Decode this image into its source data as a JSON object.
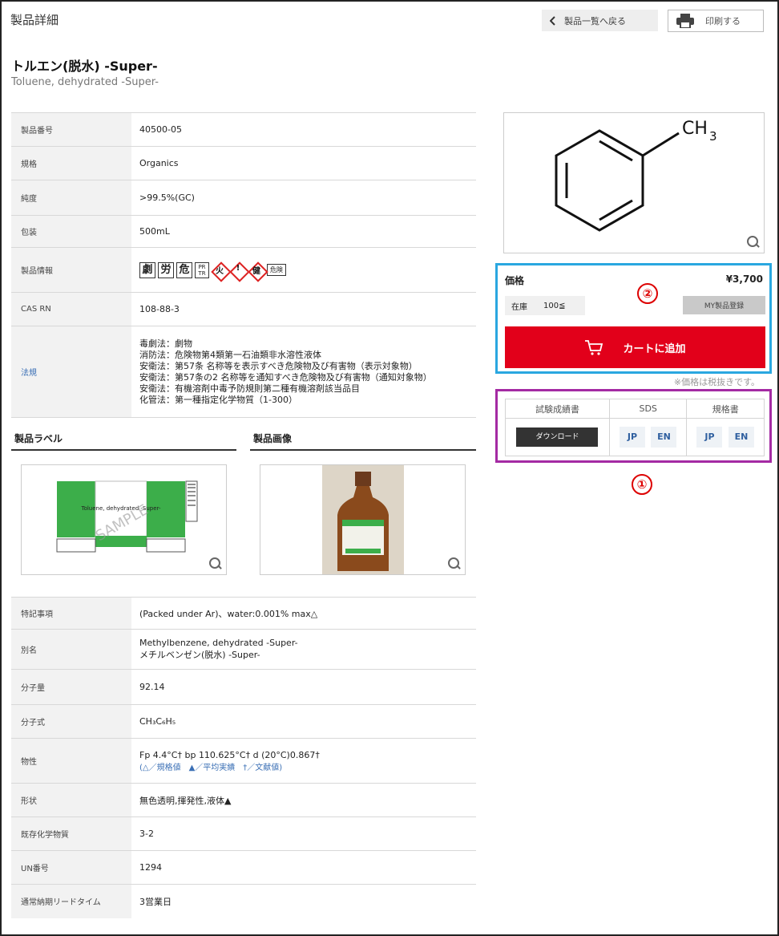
{
  "header": {
    "page_title": "製品詳細",
    "back_label": "製品一覧へ戻る",
    "print_label": "印刷する"
  },
  "product": {
    "name_jp": "トルエン(脱水) -Super-",
    "name_en": "Toluene, dehydrated -Super-"
  },
  "spec_rows": [
    {
      "key": "製品番号",
      "value": "40500-05"
    },
    {
      "key": "規格",
      "value": "Organics"
    },
    {
      "key": "純度",
      "value": ">99.5%(GC)"
    },
    {
      "key": "包装",
      "value": "500mL"
    },
    {
      "key": "製品情報",
      "value": ""
    },
    {
      "key": "CAS RN",
      "value": "108-88-3"
    },
    {
      "key": "法規",
      "value": ""
    }
  ],
  "hazard": {
    "k1": "劇",
    "k2": "労",
    "k3": "危",
    "prtr": "PR TR",
    "d1": "火",
    "d2": "!",
    "d3": "健",
    "kiken": "危険"
  },
  "law_lines": [
    "毒劇法：劇物",
    "消防法：危険物第4類第一石油類非水溶性液体",
    "安衛法：第57条 名称等を表示すべき危険物及び有害物（表示対象物）",
    "安衛法：第57条の2 名称等を通知すべき危険物及び有害物（通知対象物）",
    "安衛法：有機溶剤中毒予防規則第二種有機溶剤該当品目",
    "化管法：第一種指定化学物質（1-300）"
  ],
  "sections": {
    "label_heading": "製品ラベル",
    "image_heading": "製品画像",
    "label_sample_text": "SAMPLE",
    "label_product_text": "Toluene, dehydrated -Super-"
  },
  "structure": {
    "ch3": "CH",
    "ch3_sub": "3"
  },
  "price": {
    "label": "価格",
    "value": "¥3,700",
    "stock_label": "在庫",
    "stock_value": "100≦",
    "my_button": "MY製品登録",
    "cart_button": "カートに追加",
    "badge": "②",
    "tax_note": "※価格は税抜きです。"
  },
  "docs": {
    "col1": "試験成績書",
    "col2": "SDS",
    "col3": "規格書",
    "download": "ダウンロード",
    "jp": "JP",
    "en": "EN",
    "badge": "①"
  },
  "property_rows": [
    {
      "key": "特記事項",
      "value": "(Packed under Ar)、water:0.001% max△"
    },
    {
      "key": "別名",
      "value": "Methylbenzene, dehydrated -Super-",
      "value2": "メチルベンゼン(脱水) -Super-"
    },
    {
      "key": "分子量",
      "value": "92.14"
    },
    {
      "key": "分子式",
      "value": "CH₃C₆H₅"
    },
    {
      "key": "物性",
      "value": "Fp 4.4°C† bp 110.625°C† d (20°C)0.867†",
      "value2": "(△／規格値　▲／平均実績　†／文献値)"
    },
    {
      "key": "形状",
      "value": "無色透明,揮発性,液体▲"
    },
    {
      "key": "既存化学物質",
      "value": "3-2"
    },
    {
      "key": "UN番号",
      "value": "1294"
    },
    {
      "key": "通常納期リードタイム",
      "value": "3営業日"
    }
  ],
  "colors": {
    "cart_red": "#e2001a",
    "price_box_border": "#2aa7e0",
    "docs_box_border": "#a42aa3",
    "badge_red": "#dd0000"
  }
}
